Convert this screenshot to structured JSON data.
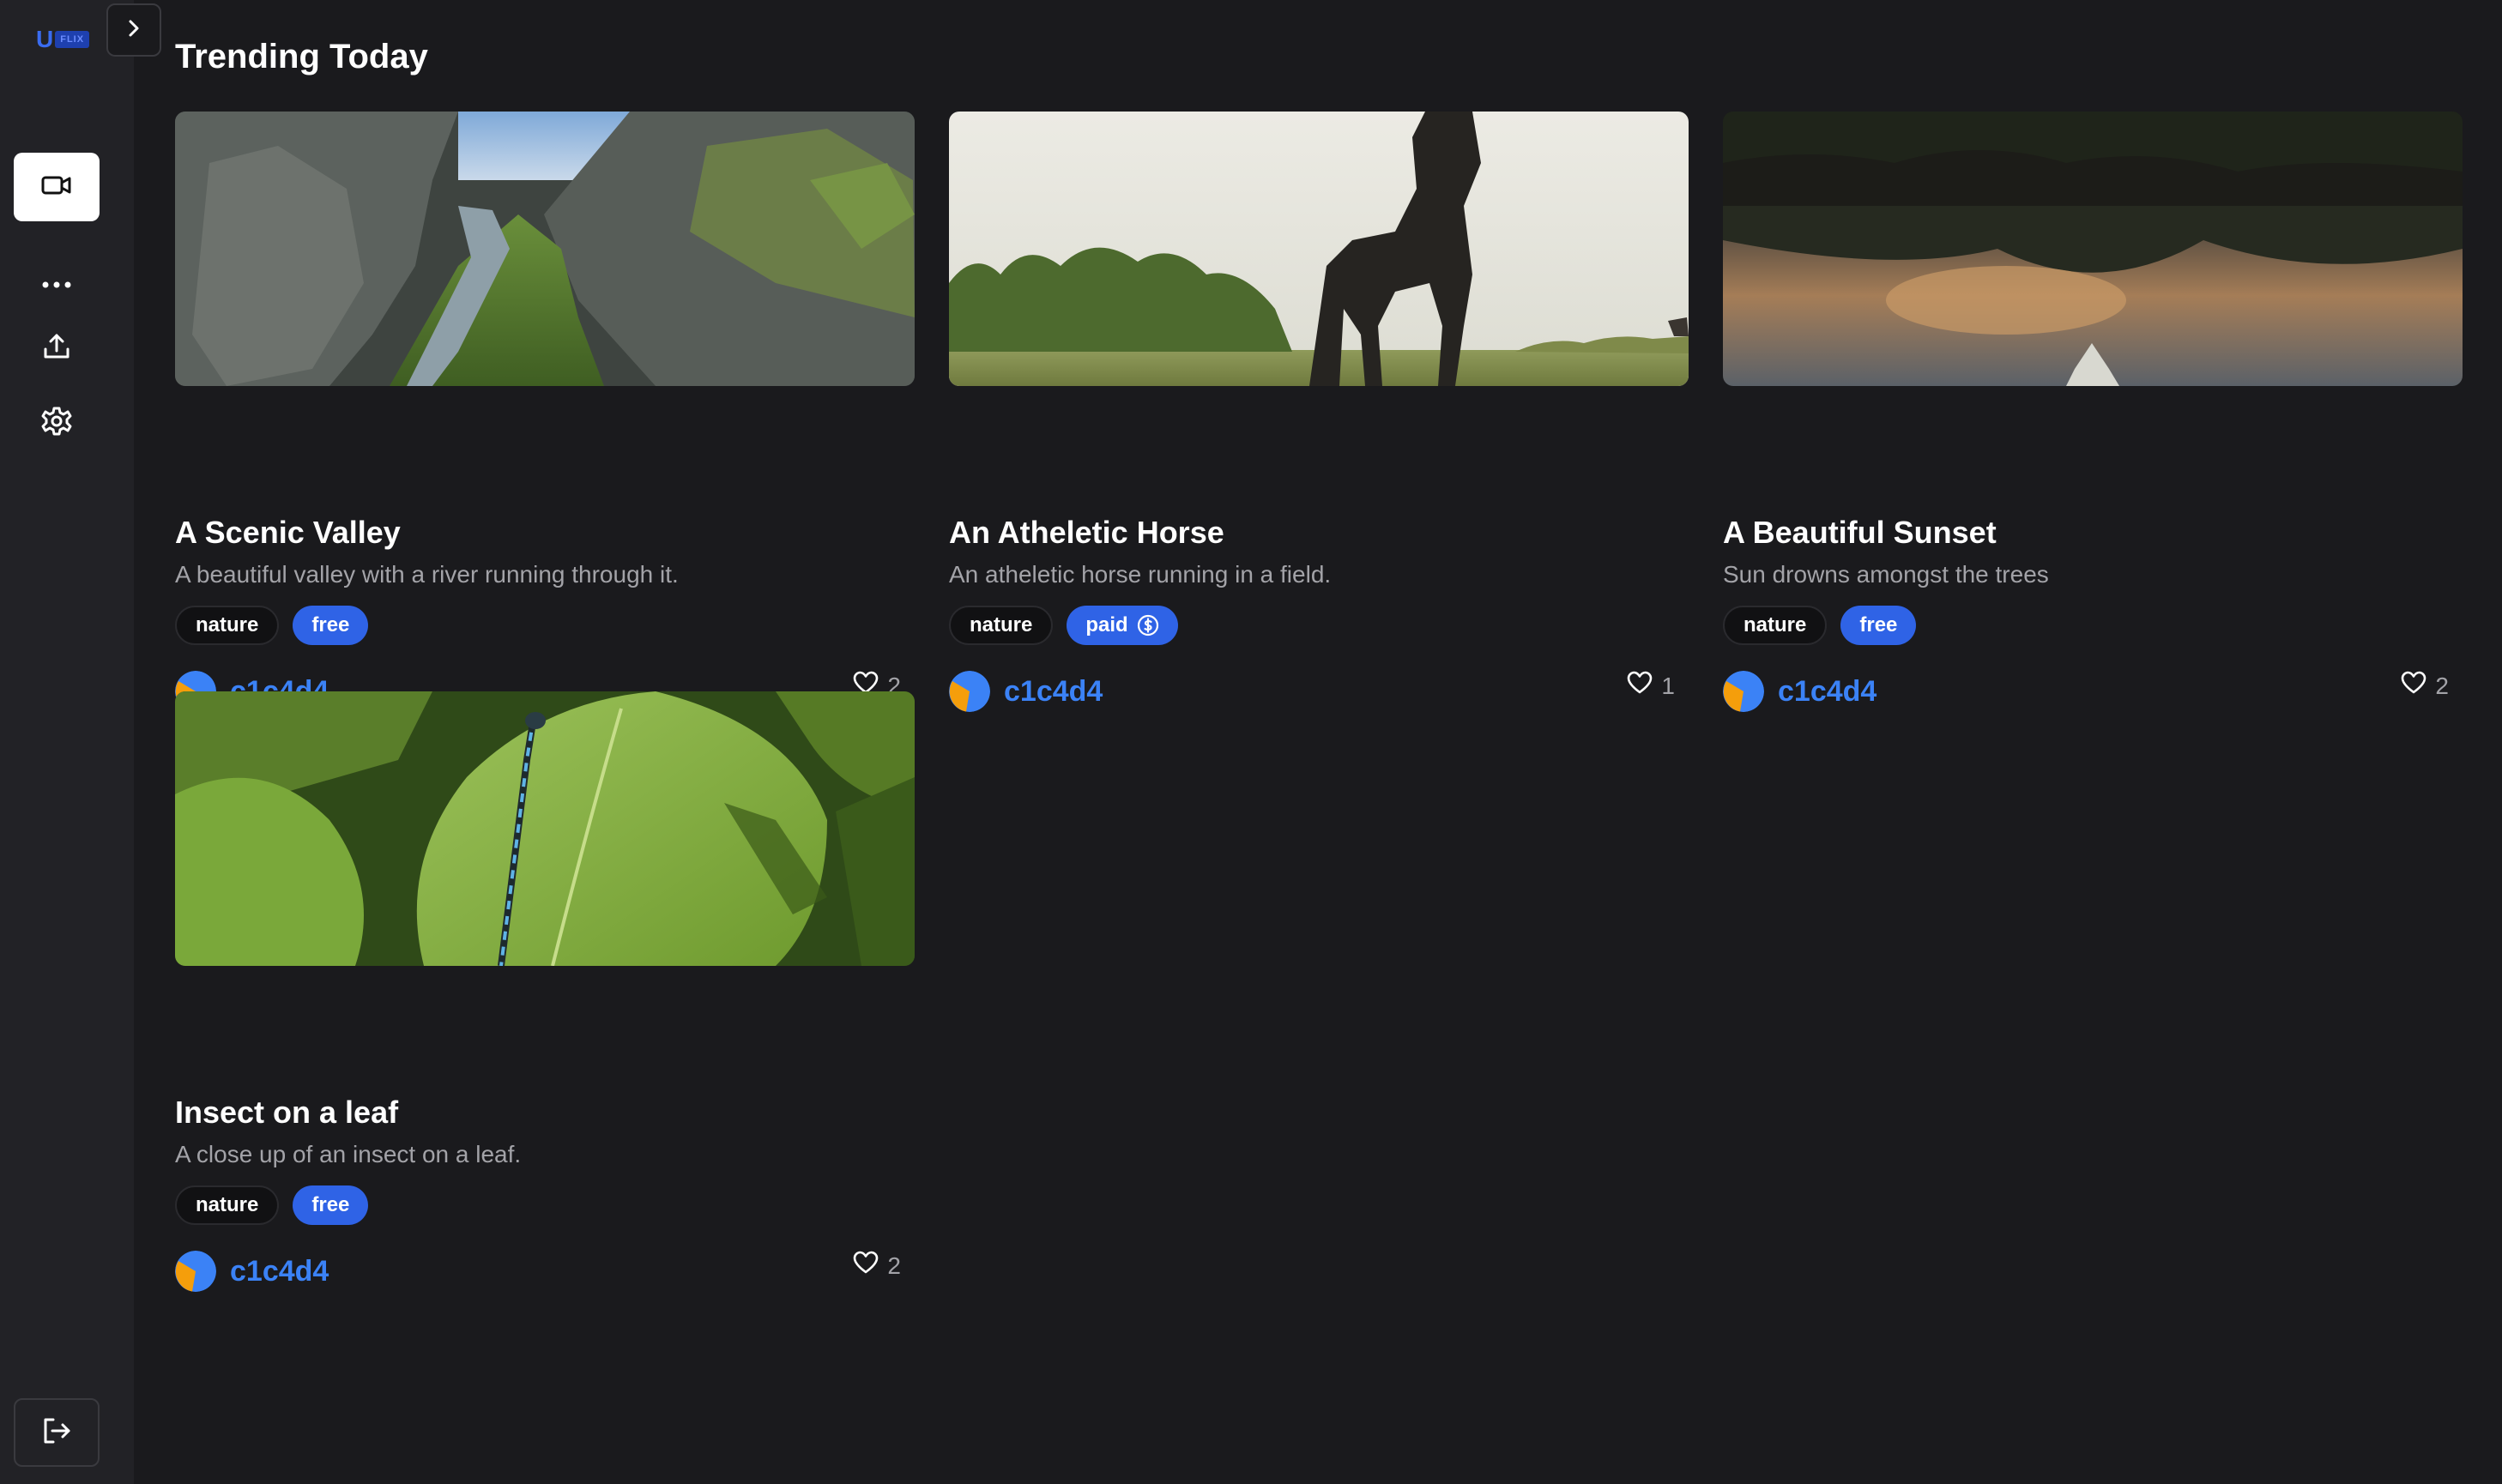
{
  "app": {
    "logo_letter": "U",
    "logo_text": "FLIX"
  },
  "sidebar": {
    "items": [
      {
        "name": "videos",
        "icon": "video-camera-icon",
        "active": true
      },
      {
        "name": "more",
        "icon": "more-dots-icon",
        "active": false
      },
      {
        "name": "upload",
        "icon": "upload-icon",
        "active": false
      },
      {
        "name": "settings",
        "icon": "gear-icon",
        "active": false
      }
    ],
    "logout_icon": "logout-icon"
  },
  "main": {
    "title": "Trending Today",
    "cards": [
      {
        "title": "A Scenic Valley",
        "description": "A beautiful valley with a river running through it.",
        "tags": [
          "nature",
          "free"
        ],
        "author": "c1c4d4",
        "likes": "2",
        "thumbnail": "canyon-valley-river"
      },
      {
        "title": "An Atheletic Horse",
        "description": "An atheletic horse running in a field.",
        "tags": [
          "nature",
          "paid"
        ],
        "author": "c1c4d4",
        "likes": "1",
        "thumbnail": "horse-in-field"
      },
      {
        "title": "A Beautiful Sunset",
        "description": "Sun drowns amongst the trees",
        "tags": [
          "nature",
          "free"
        ],
        "author": "c1c4d4",
        "likes": "2",
        "thumbnail": "sunset-lake-reflection"
      },
      {
        "title": "Insect on a leaf",
        "description": "A close up of an insect on a leaf.",
        "tags": [
          "nature",
          "free"
        ],
        "author": "c1c4d4",
        "likes": "2",
        "thumbnail": "dragonfly-on-leaf"
      }
    ]
  },
  "colors": {
    "background": "#1a1a1d",
    "sidebar": "#222226",
    "accent": "#2f63e6",
    "author": "#3b82f6",
    "muted_text": "#a3a3a8"
  }
}
